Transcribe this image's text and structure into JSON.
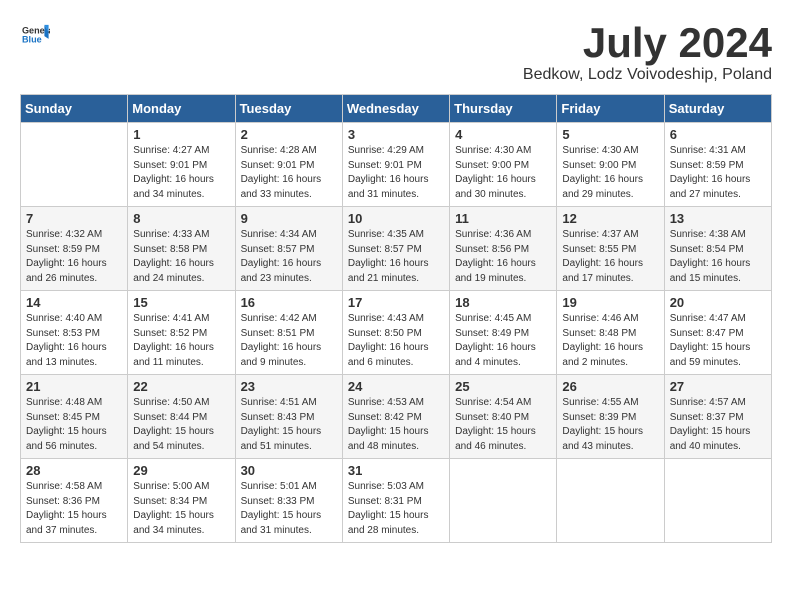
{
  "header": {
    "logo_general": "General",
    "logo_blue": "Blue",
    "month_year": "July 2024",
    "location": "Bedkow, Lodz Voivodeship, Poland"
  },
  "days_of_week": [
    "Sunday",
    "Monday",
    "Tuesday",
    "Wednesday",
    "Thursday",
    "Friday",
    "Saturday"
  ],
  "weeks": [
    [
      {
        "day": "",
        "info": ""
      },
      {
        "day": "1",
        "info": "Sunrise: 4:27 AM\nSunset: 9:01 PM\nDaylight: 16 hours and 34 minutes."
      },
      {
        "day": "2",
        "info": "Sunrise: 4:28 AM\nSunset: 9:01 PM\nDaylight: 16 hours and 33 minutes."
      },
      {
        "day": "3",
        "info": "Sunrise: 4:29 AM\nSunset: 9:01 PM\nDaylight: 16 hours and 31 minutes."
      },
      {
        "day": "4",
        "info": "Sunrise: 4:30 AM\nSunset: 9:00 PM\nDaylight: 16 hours and 30 minutes."
      },
      {
        "day": "5",
        "info": "Sunrise: 4:30 AM\nSunset: 9:00 PM\nDaylight: 16 hours and 29 minutes."
      },
      {
        "day": "6",
        "info": "Sunrise: 4:31 AM\nSunset: 8:59 PM\nDaylight: 16 hours and 27 minutes."
      }
    ],
    [
      {
        "day": "7",
        "info": "Sunrise: 4:32 AM\nSunset: 8:59 PM\nDaylight: 16 hours and 26 minutes."
      },
      {
        "day": "8",
        "info": "Sunrise: 4:33 AM\nSunset: 8:58 PM\nDaylight: 16 hours and 24 minutes."
      },
      {
        "day": "9",
        "info": "Sunrise: 4:34 AM\nSunset: 8:57 PM\nDaylight: 16 hours and 23 minutes."
      },
      {
        "day": "10",
        "info": "Sunrise: 4:35 AM\nSunset: 8:57 PM\nDaylight: 16 hours and 21 minutes."
      },
      {
        "day": "11",
        "info": "Sunrise: 4:36 AM\nSunset: 8:56 PM\nDaylight: 16 hours and 19 minutes."
      },
      {
        "day": "12",
        "info": "Sunrise: 4:37 AM\nSunset: 8:55 PM\nDaylight: 16 hours and 17 minutes."
      },
      {
        "day": "13",
        "info": "Sunrise: 4:38 AM\nSunset: 8:54 PM\nDaylight: 16 hours and 15 minutes."
      }
    ],
    [
      {
        "day": "14",
        "info": "Sunrise: 4:40 AM\nSunset: 8:53 PM\nDaylight: 16 hours and 13 minutes."
      },
      {
        "day": "15",
        "info": "Sunrise: 4:41 AM\nSunset: 8:52 PM\nDaylight: 16 hours and 11 minutes."
      },
      {
        "day": "16",
        "info": "Sunrise: 4:42 AM\nSunset: 8:51 PM\nDaylight: 16 hours and 9 minutes."
      },
      {
        "day": "17",
        "info": "Sunrise: 4:43 AM\nSunset: 8:50 PM\nDaylight: 16 hours and 6 minutes."
      },
      {
        "day": "18",
        "info": "Sunrise: 4:45 AM\nSunset: 8:49 PM\nDaylight: 16 hours and 4 minutes."
      },
      {
        "day": "19",
        "info": "Sunrise: 4:46 AM\nSunset: 8:48 PM\nDaylight: 16 hours and 2 minutes."
      },
      {
        "day": "20",
        "info": "Sunrise: 4:47 AM\nSunset: 8:47 PM\nDaylight: 15 hours and 59 minutes."
      }
    ],
    [
      {
        "day": "21",
        "info": "Sunrise: 4:48 AM\nSunset: 8:45 PM\nDaylight: 15 hours and 56 minutes."
      },
      {
        "day": "22",
        "info": "Sunrise: 4:50 AM\nSunset: 8:44 PM\nDaylight: 15 hours and 54 minutes."
      },
      {
        "day": "23",
        "info": "Sunrise: 4:51 AM\nSunset: 8:43 PM\nDaylight: 15 hours and 51 minutes."
      },
      {
        "day": "24",
        "info": "Sunrise: 4:53 AM\nSunset: 8:42 PM\nDaylight: 15 hours and 48 minutes."
      },
      {
        "day": "25",
        "info": "Sunrise: 4:54 AM\nSunset: 8:40 PM\nDaylight: 15 hours and 46 minutes."
      },
      {
        "day": "26",
        "info": "Sunrise: 4:55 AM\nSunset: 8:39 PM\nDaylight: 15 hours and 43 minutes."
      },
      {
        "day": "27",
        "info": "Sunrise: 4:57 AM\nSunset: 8:37 PM\nDaylight: 15 hours and 40 minutes."
      }
    ],
    [
      {
        "day": "28",
        "info": "Sunrise: 4:58 AM\nSunset: 8:36 PM\nDaylight: 15 hours and 37 minutes."
      },
      {
        "day": "29",
        "info": "Sunrise: 5:00 AM\nSunset: 8:34 PM\nDaylight: 15 hours and 34 minutes."
      },
      {
        "day": "30",
        "info": "Sunrise: 5:01 AM\nSunset: 8:33 PM\nDaylight: 15 hours and 31 minutes."
      },
      {
        "day": "31",
        "info": "Sunrise: 5:03 AM\nSunset: 8:31 PM\nDaylight: 15 hours and 28 minutes."
      },
      {
        "day": "",
        "info": ""
      },
      {
        "day": "",
        "info": ""
      },
      {
        "day": "",
        "info": ""
      }
    ]
  ]
}
